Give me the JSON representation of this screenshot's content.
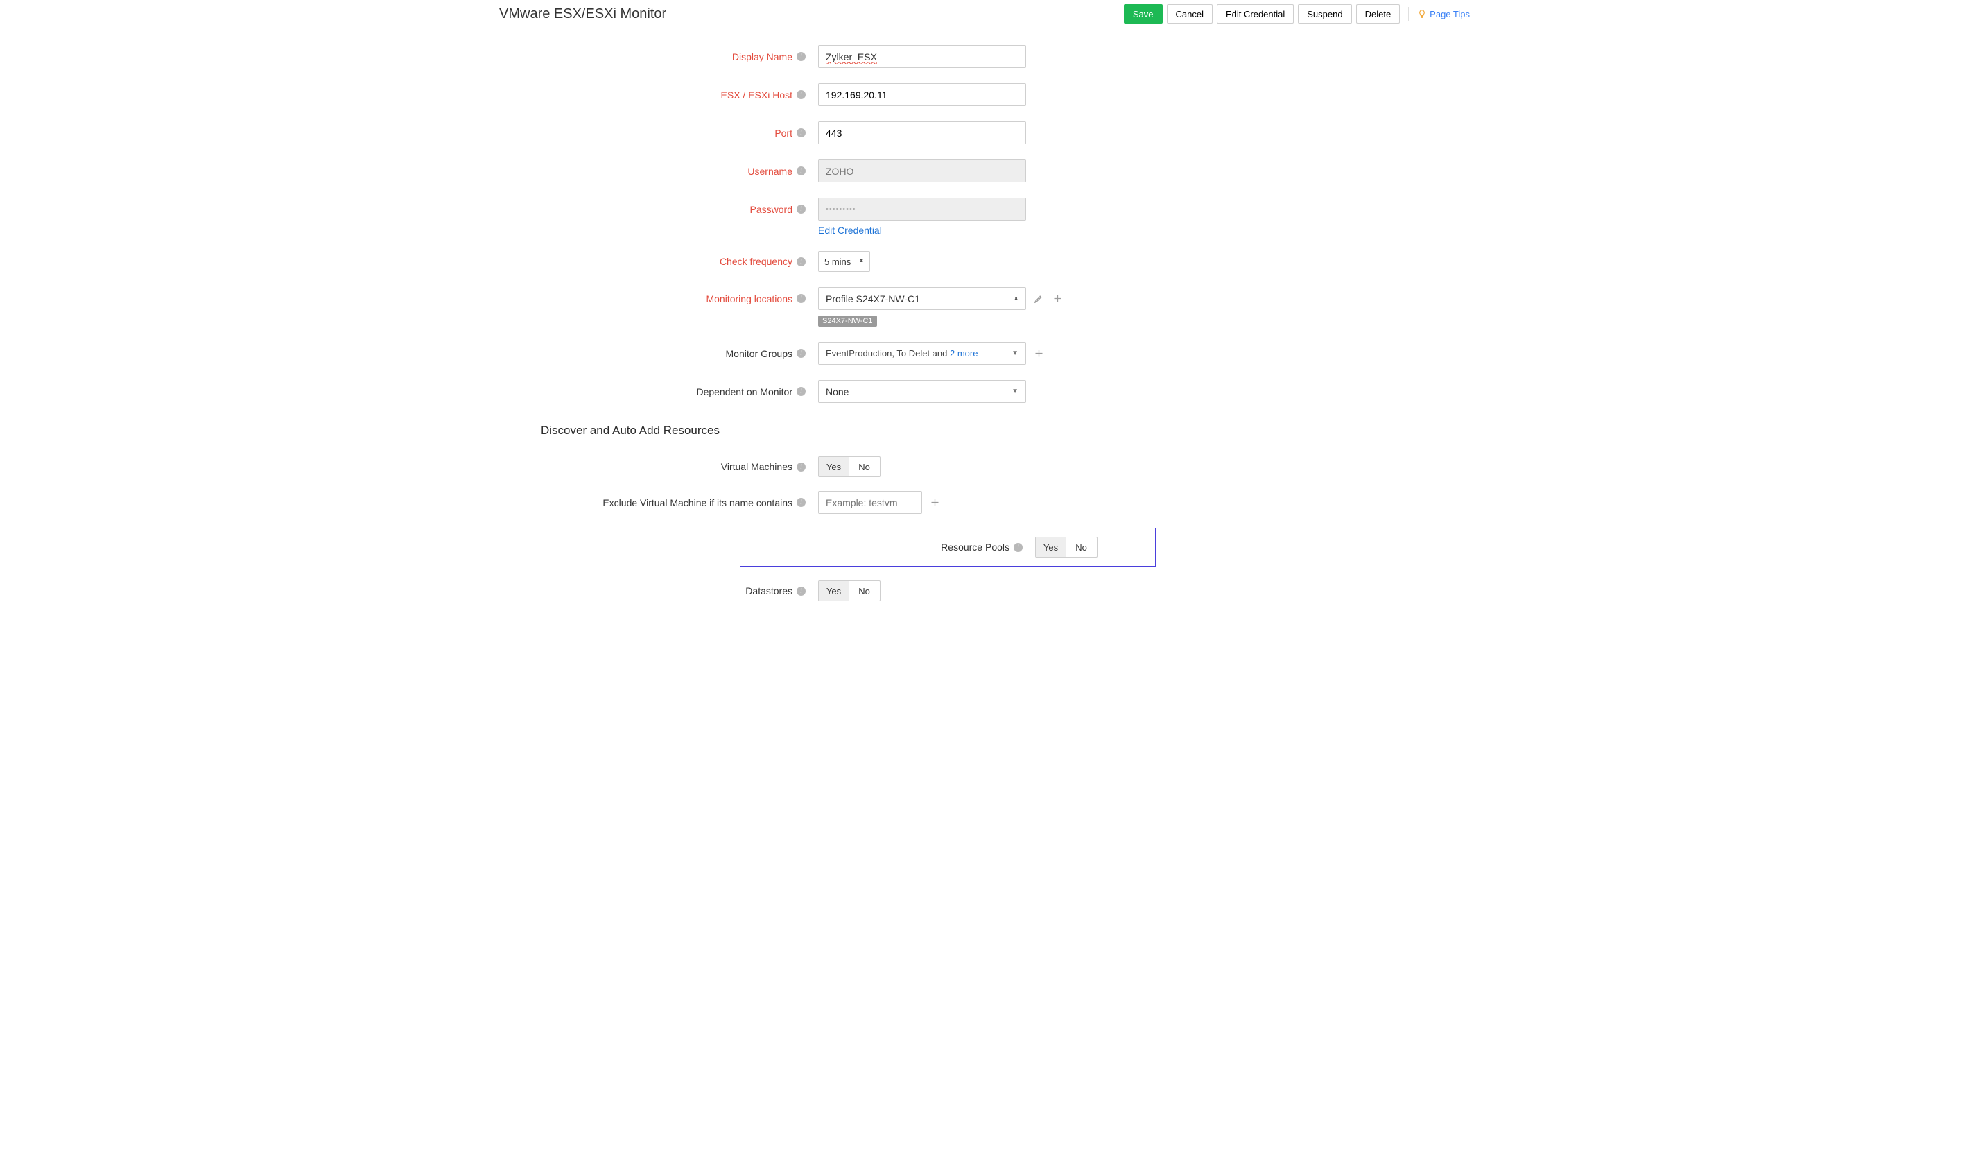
{
  "page_title": "VMware ESX/ESXi Monitor",
  "buttons": {
    "save": "Save",
    "cancel": "Cancel",
    "edit_cred": "Edit Credential",
    "suspend": "Suspend",
    "delete": "Delete"
  },
  "page_tips": "Page Tips",
  "fields": {
    "display_name": {
      "label": "Display Name",
      "value": "Zylker_ESX"
    },
    "host": {
      "label": "ESX / ESXi Host",
      "value": "192.169.20.11"
    },
    "port": {
      "label": "Port",
      "value": "443"
    },
    "username": {
      "label": "Username",
      "value": "ZOHO"
    },
    "password": {
      "label": "Password",
      "value": "•••••••••"
    },
    "edit_credential_link": "Edit Credential",
    "check_freq": {
      "label": "Check frequency",
      "value": "5 mins"
    },
    "locations": {
      "label": "Monitoring locations",
      "value": "Profile S24X7-NW-C1",
      "tag": "S24X7-NW-C1"
    },
    "monitor_groups": {
      "label": "Monitor Groups",
      "prefix": "EventProduction, To Delet and ",
      "more": "2 more"
    },
    "dependent": {
      "label": "Dependent on Monitor",
      "value": "None"
    }
  },
  "section_discover": {
    "title": "Discover and Auto Add Resources",
    "vms": {
      "label": "Virtual Machines",
      "yes": "Yes",
      "no": "No"
    },
    "exclude": {
      "label": "Exclude Virtual Machine if its name contains",
      "placeholder": "Example: testvm"
    },
    "resource_pools": {
      "label": "Resource Pools",
      "yes": "Yes",
      "no": "No"
    },
    "datastores": {
      "label": "Datastores",
      "yes": "Yes",
      "no": "No"
    }
  }
}
